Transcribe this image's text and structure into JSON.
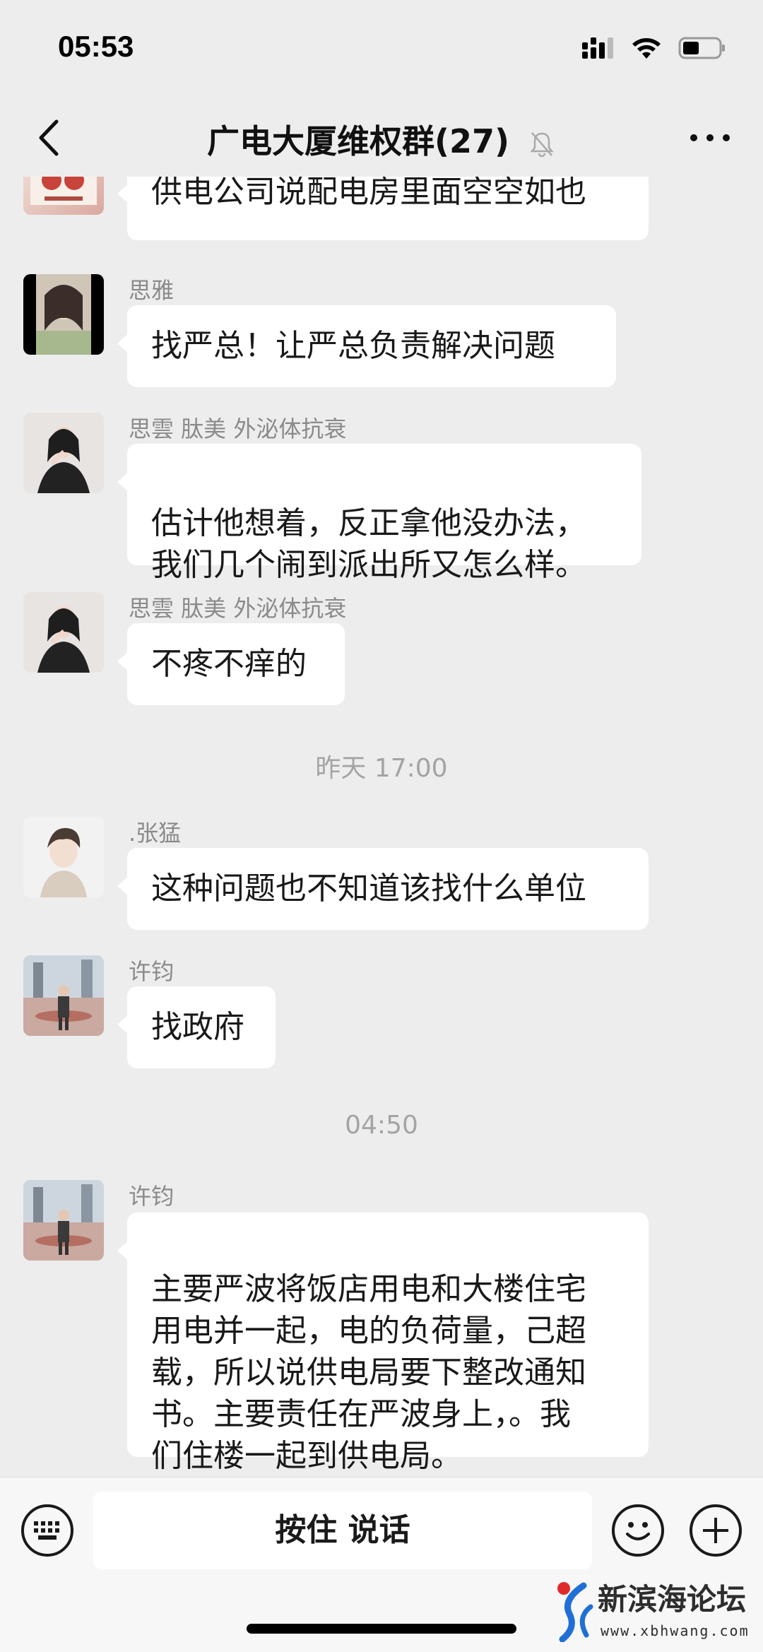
{
  "status": {
    "time": "05:53"
  },
  "nav": {
    "title": "广电大厦维权群(27)"
  },
  "messages": [
    {
      "sender": "",
      "text": "供电公司说配电房里面空空如也"
    },
    {
      "sender": "思雅",
      "text": "找严总！让严总负责解决问题"
    },
    {
      "sender": "思雲 肽美 外泌体抗衰",
      "text": "估计他想着，反正拿他没办法，\n我们几个闹到派出所又怎么样。"
    },
    {
      "sender": "思雲 肽美 外泌体抗衰",
      "text": "不疼不痒的"
    },
    {
      "sender": ".张猛",
      "text": "这种问题也不知道该找什么单位"
    },
    {
      "sender": "许钧",
      "text": "找政府"
    },
    {
      "sender": "许钧",
      "text": "主要严波将饭店用电和大楼住宅\n用电并一起，电的负荷量，己超\n载，所以说供电局要下整改通知\n书。主要责任在严波身上，。我\n们住楼一起到供电局。"
    }
  ],
  "time_separators": [
    "昨天 17:00",
    "04:50"
  ],
  "input": {
    "voice_label": "按住 说话"
  },
  "watermark": {
    "name": "新滨海论坛",
    "url": "www.xbhwang.com"
  }
}
